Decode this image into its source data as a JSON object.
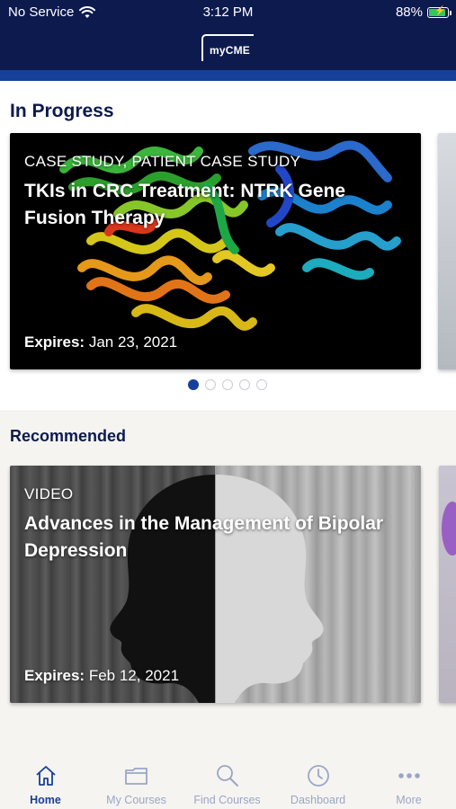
{
  "status_bar": {
    "carrier": "No Service",
    "time": "3:12 PM",
    "battery": "88%",
    "battery_level": 0.88
  },
  "header": {
    "logo_text": "myCME"
  },
  "in_progress": {
    "title": "In Progress",
    "card": {
      "kicker": "CASE STUDY, PATIENT CASE STUDY",
      "title": "TKIs in CRC Treatment: NTRK Gene Fusion Therapy",
      "expires_label": "Expires:",
      "expires_date": "Jan 23, 2021"
    },
    "pagination": {
      "count": 5,
      "active_index": 0
    }
  },
  "recommended": {
    "title": "Recommended",
    "card": {
      "kicker": "VIDEO",
      "title": "Advances in the Management of Bipolar Depression",
      "expires_label": "Expires:",
      "expires_date": "Feb 12, 2021"
    }
  },
  "tab_bar": {
    "tabs": [
      {
        "label": "Home",
        "icon": "home-icon",
        "active": true
      },
      {
        "label": "My Courses",
        "icon": "folder-icon",
        "active": false
      },
      {
        "label": "Find Courses",
        "icon": "search-icon",
        "active": false
      },
      {
        "label": "Dashboard",
        "icon": "clock-icon",
        "active": false
      },
      {
        "label": "More",
        "icon": "more-dots-icon",
        "active": false
      }
    ]
  },
  "colors": {
    "header_navy": "#0c1a4e",
    "accent_blue": "#17409a",
    "tab_inactive": "#9aa6c6",
    "battery_green": "#34c759"
  }
}
